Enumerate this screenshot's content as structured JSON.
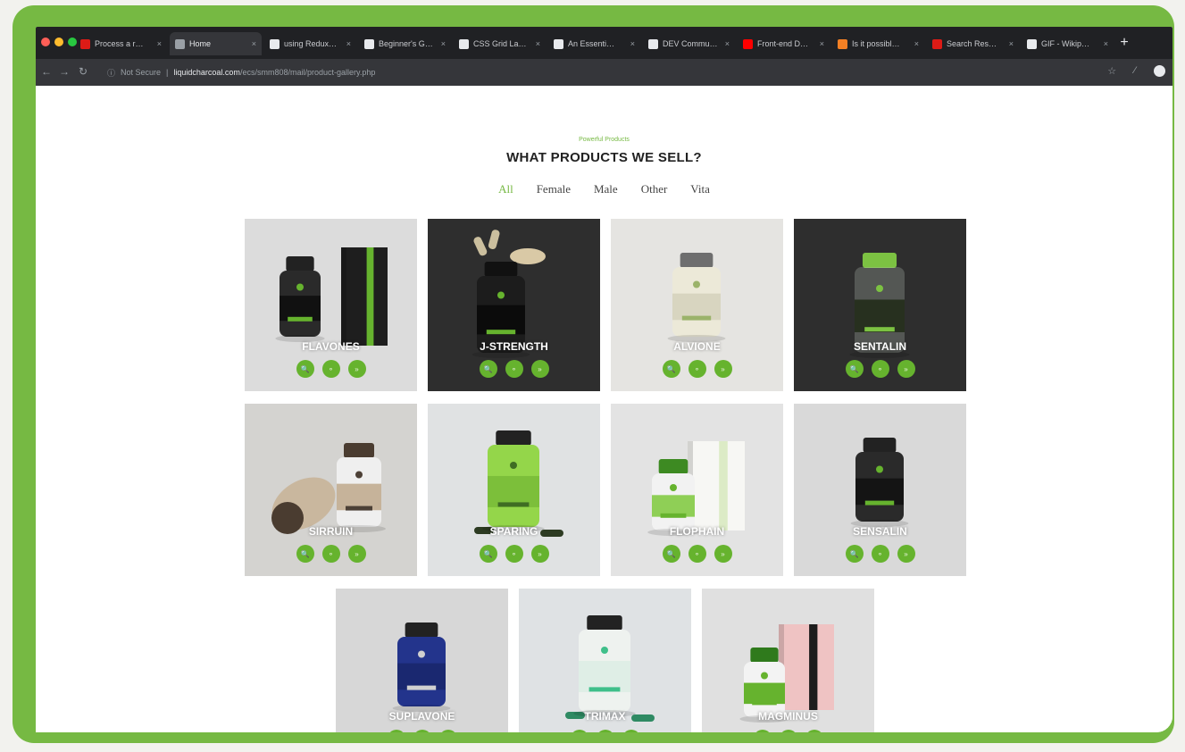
{
  "browser": {
    "tabs": [
      {
        "label": "Process a r…",
        "icon": "angular-icon",
        "color": "#dd1b16"
      },
      {
        "label": "Home",
        "icon": "page-icon",
        "color": "#9aa0a6",
        "active": true
      },
      {
        "label": "using Redux…",
        "icon": "globe-icon",
        "color": "#e8eaed"
      },
      {
        "label": "Beginner's G…",
        "icon": "medium-icon",
        "color": "#e8eaed"
      },
      {
        "label": "CSS Grid La…",
        "icon": "grid-icon",
        "color": "#e8eaed"
      },
      {
        "label": "An Essenti…",
        "icon": "grid-icon",
        "color": "#e8eaed"
      },
      {
        "label": "DEV Commu…",
        "icon": "dev-icon",
        "color": "#e8eaed"
      },
      {
        "label": "Front-end D…",
        "icon": "youtube-icon",
        "color": "#ff0000"
      },
      {
        "label": "Is it possibl…",
        "icon": "stackoverflow-icon",
        "color": "#f48024"
      },
      {
        "label": "Search Res…",
        "icon": "angular-icon",
        "color": "#dd1b16"
      },
      {
        "label": "GIF - Wikip…",
        "icon": "wiki-icon",
        "color": "#e8eaed"
      }
    ],
    "security": "Not Secure",
    "url_host": "liquidcharcoal.com",
    "url_path": "/ecs/smm808/mail/product-gallery.php"
  },
  "page": {
    "kicker": "Powerful Products",
    "heading": "WHAT PRODUCTS WE SELL?",
    "filters": [
      "All",
      "Female",
      "Male",
      "Other",
      "Vita"
    ],
    "active_filter": "All"
  },
  "products": [
    {
      "name": "FLAVONES",
      "bg": "#dcdcdc",
      "dark": false,
      "style": "jar-box",
      "jar": "#2a2a2a",
      "accent": "#66b32e"
    },
    {
      "name": "J-STRENGTH",
      "bg": "#2e2e2e",
      "dark": true,
      "style": "open-jar",
      "jar": "#1c1c1c",
      "accent": "#66b32e"
    },
    {
      "name": "ALVIONE",
      "bg": "#e5e4e1",
      "dark": false,
      "style": "jar",
      "jar": "#ece9d8",
      "accent": "#9bb36a"
    },
    {
      "name": "SENTALIN",
      "bg": "#2e2e2e",
      "dark": true,
      "style": "clear-jar",
      "jar": "#3a3f38",
      "accent": "#7cc242"
    },
    {
      "name": "SIRRUIN",
      "bg": "#d4d3d0",
      "dark": false,
      "style": "two-jars",
      "jar": "#c6b39a",
      "accent": "#4c4036"
    },
    {
      "name": "SPARING",
      "bg": "#e0e2e3",
      "dark": false,
      "style": "jar-pills",
      "jar": "#94d64a",
      "accent": "#3f6d23"
    },
    {
      "name": "FLOPHAIN",
      "bg": "#e3e3e3",
      "dark": false,
      "style": "jar-box-light",
      "jar": "#f2f2f2",
      "accent": "#cfe8a8"
    },
    {
      "name": "SENSALIN",
      "bg": "#d9d9d9",
      "dark": false,
      "style": "jar",
      "jar": "#2a2a2a",
      "accent": "#66b32e"
    },
    {
      "name": "SUPLAVONE",
      "bg": "#d7d7d7",
      "dark": false,
      "style": "jar",
      "jar": "#23348c",
      "accent": "#d0d0d0"
    },
    {
      "name": "TRIMAX",
      "bg": "#dfe2e4",
      "dark": false,
      "style": "jar-pills",
      "jar": "#eef2ef",
      "accent": "#3fbf8a"
    },
    {
      "name": "MAGMINUS",
      "bg": "#e0e0e0",
      "dark": false,
      "style": "jar-box-pink",
      "jar": "#f3f3f3",
      "accent": "#66b32e"
    }
  ],
  "actions": [
    {
      "label": "🔍",
      "icon": "search-icon"
    },
    {
      "label": "⚬",
      "icon": "link-icon"
    },
    {
      "label": "»",
      "icon": "cart-icon"
    }
  ],
  "colors": {
    "brand_green": "#76b943",
    "button_green": "#66b32e"
  }
}
